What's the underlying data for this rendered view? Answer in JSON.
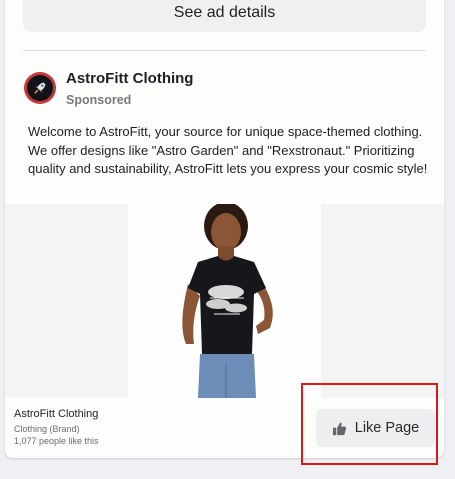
{
  "ad": {
    "see_details_label": "See ad details",
    "page_name": "AstroFitt Clothing",
    "sponsored_label": "Sponsored",
    "body_text": "Welcome to AstroFitt, your source for unique space-themed clothing. We offer designs like \"Astro Garden\" and \"Rexstronaut.\" Prioritizing quality and sustainability, AstroFitt lets you express your cosmic style!",
    "footer": {
      "name": "AstroFitt Clothing",
      "category": "Clothing (Brand)",
      "likes": "1,077 people like this"
    },
    "like_button_label": "Like Page"
  },
  "colors": {
    "highlight": "#e01717",
    "avatar_ring": "#c43a3a"
  },
  "icons": {
    "avatar": "rocket-icon",
    "like": "thumbs-up-icon"
  }
}
